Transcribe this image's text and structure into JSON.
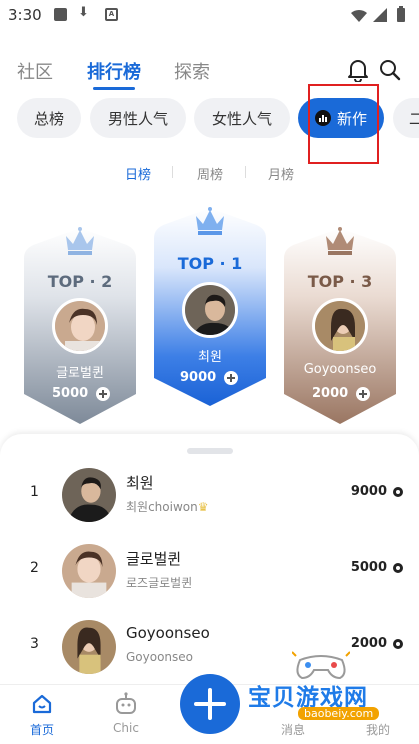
{
  "status_bar": {
    "time": "3:30",
    "a_icon_letter": "A"
  },
  "top_nav": {
    "tabs": [
      {
        "label": "社区",
        "active": false
      },
      {
        "label": "排行榜",
        "active": true
      },
      {
        "label": "探索",
        "active": false
      }
    ]
  },
  "categories": [
    {
      "label": "总榜",
      "active": false
    },
    {
      "label": "男性人气",
      "active": false
    },
    {
      "label": "女性人气",
      "active": false
    },
    {
      "label": "新作",
      "active": true
    },
    {
      "label": "二",
      "active": false
    }
  ],
  "periods": [
    {
      "label": "日榜",
      "active": true
    },
    {
      "label": "周榜",
      "active": false
    },
    {
      "label": "月榜",
      "active": false
    }
  ],
  "podium": {
    "first": {
      "title": "TOP · 1",
      "name": "최원",
      "score": "9000"
    },
    "second": {
      "title": "TOP · 2",
      "name": "글로벌퀸",
      "score": "5000"
    },
    "third": {
      "title": "TOP · 3",
      "name": "Goyoonseo",
      "score": "2000"
    }
  },
  "ranking": [
    {
      "rank": "1",
      "name": "최원",
      "sub": "최원choiwon",
      "value": "9000"
    },
    {
      "rank": "2",
      "name": "글로벌퀸",
      "sub": "로즈글로벌퀸",
      "value": "5000"
    },
    {
      "rank": "3",
      "name": "Goyoonseo",
      "sub": "Goyoonseo",
      "value": "2000"
    }
  ],
  "bottom_nav": {
    "items": [
      {
        "label": "首页",
        "active": true
      },
      {
        "label": "Chic",
        "active": false
      },
      {
        "label": "消息",
        "active": false
      },
      {
        "label": "我的",
        "active": false
      }
    ]
  },
  "watermark": {
    "title": "宝贝游戏网",
    "url": "baobeiy.com"
  },
  "colors": {
    "accent": "#1a6ad8",
    "highlight_box": "#e02020",
    "second_place": "#7e8a99",
    "third_place": "#9a7662"
  }
}
